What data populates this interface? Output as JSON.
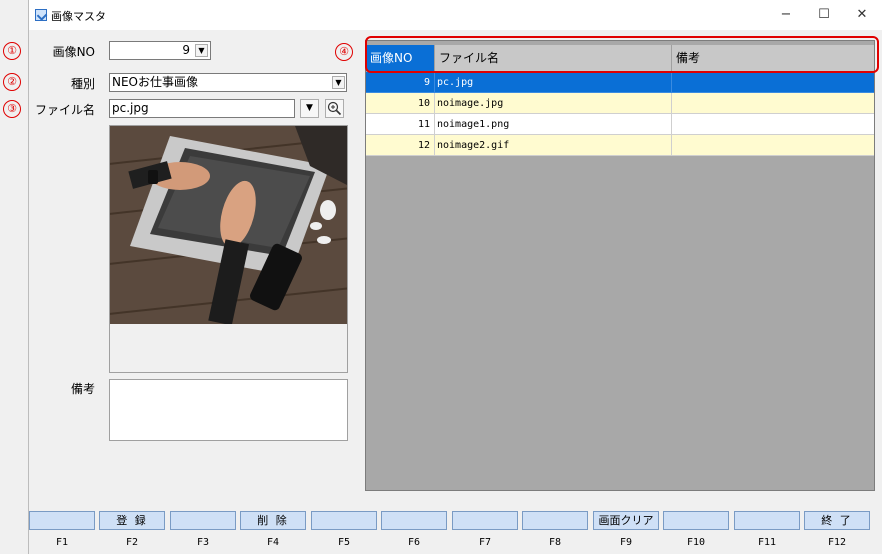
{
  "window": {
    "title": "画像マスタ",
    "minimize": "−",
    "maximize": "☐",
    "close": "✕"
  },
  "annotations": [
    "①",
    "②",
    "③",
    "④"
  ],
  "form": {
    "image_no_label": "画像NO",
    "image_no_value": "9",
    "category_label": "種別",
    "category_value": "NEOお仕事画像",
    "filename_label": "ファイル名",
    "filename_value": "pc.jpg",
    "remarks_label": "備考",
    "remarks_value": ""
  },
  "grid": {
    "headers": [
      "画像NO",
      "ファイル名",
      "備考"
    ],
    "rows": [
      {
        "no": "9",
        "file": "pc.jpg",
        "remarks": "",
        "selected": true
      },
      {
        "no": "10",
        "file": "noimage.jpg",
        "remarks": ""
      },
      {
        "no": "11",
        "file": "noimage1.png",
        "remarks": ""
      },
      {
        "no": "12",
        "file": "noimage2.gif",
        "remarks": ""
      }
    ]
  },
  "fkeys": [
    {
      "label": "",
      "key": "F1"
    },
    {
      "label": "登 録",
      "key": "F2"
    },
    {
      "label": "",
      "key": "F3"
    },
    {
      "label": "削 除",
      "key": "F4"
    },
    {
      "label": "",
      "key": "F5"
    },
    {
      "label": "",
      "key": "F6"
    },
    {
      "label": "",
      "key": "F7"
    },
    {
      "label": "",
      "key": "F8"
    },
    {
      "label": "画面クリア",
      "key": "F9"
    },
    {
      "label": "",
      "key": "F10"
    },
    {
      "label": "",
      "key": "F11"
    },
    {
      "label": "終 了",
      "key": "F12"
    }
  ],
  "colors": {
    "selected_row": "#0a6fd6",
    "alt_row": "#fffbd0",
    "fkey_bg": "#cfe0f6",
    "annotation": "#e00000"
  }
}
